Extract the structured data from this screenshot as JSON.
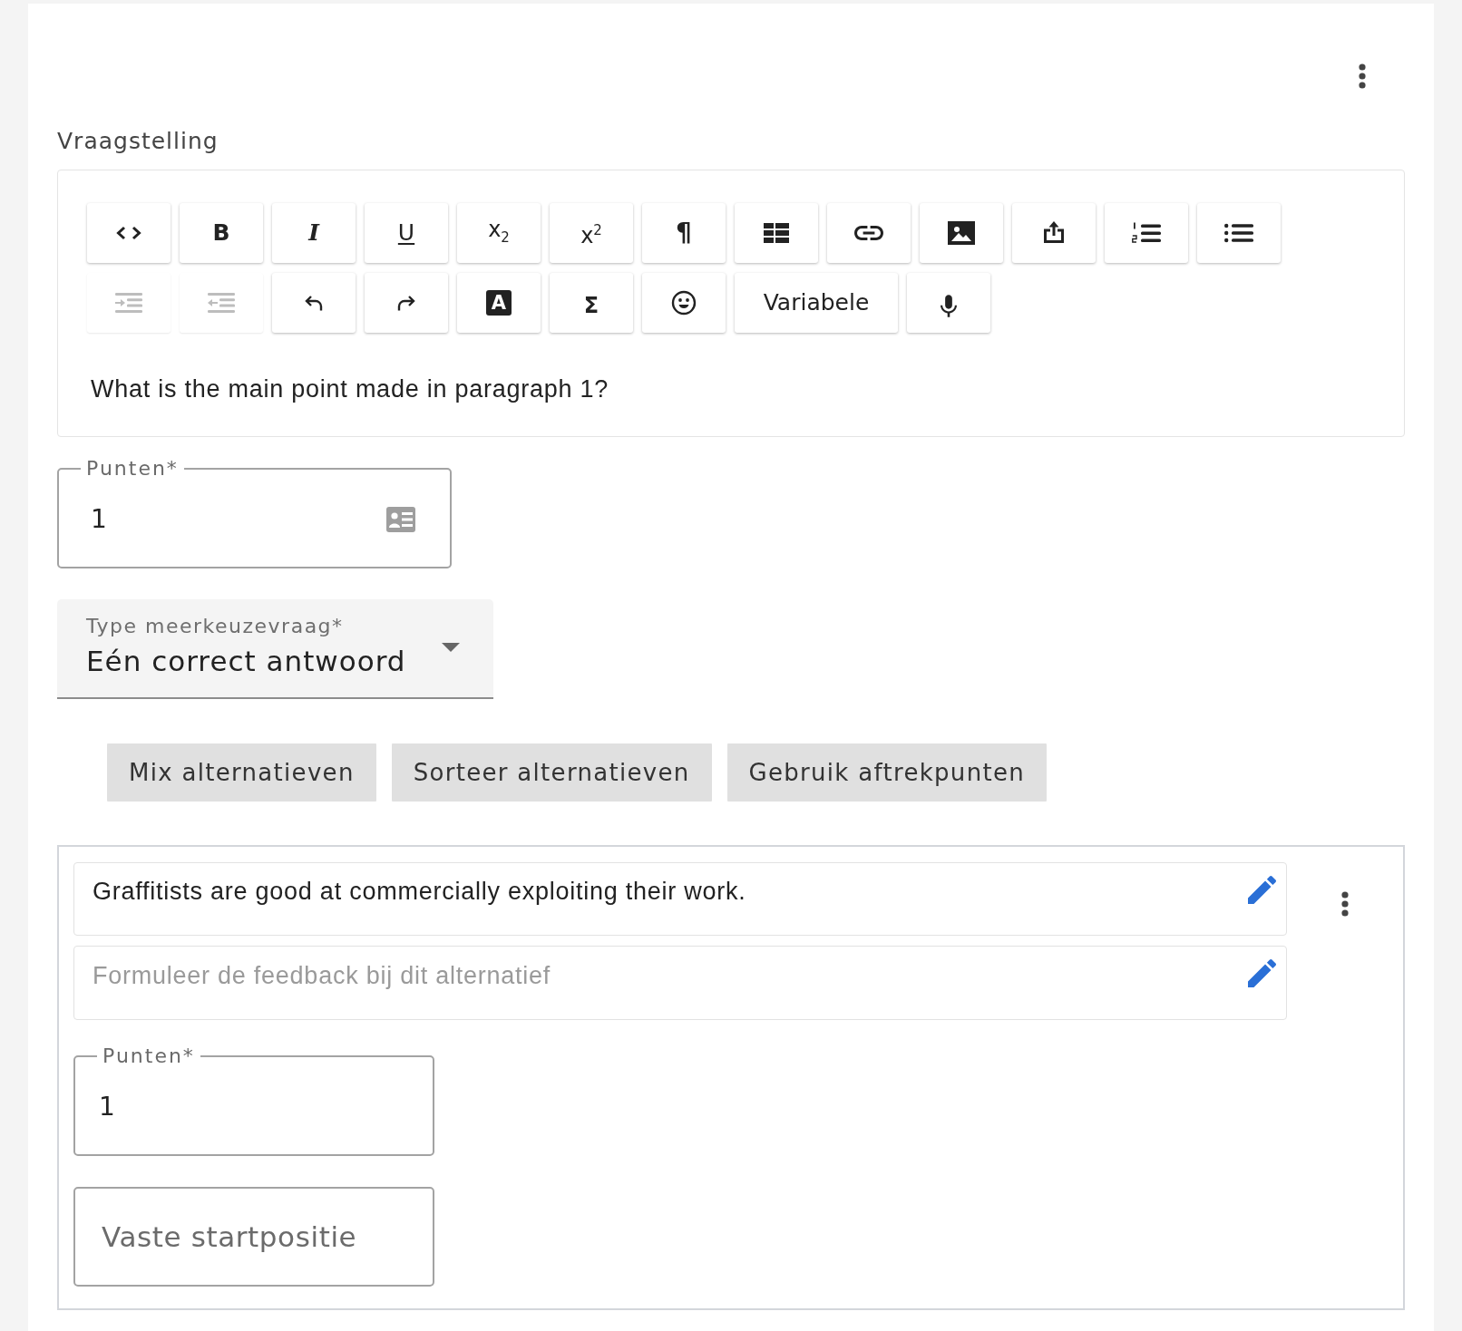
{
  "question": {
    "label": "Vraagstelling",
    "toolbar_rows": [
      [
        {
          "kind": "code",
          "disabled": false
        },
        {
          "kind": "bold",
          "label": "B",
          "disabled": false
        },
        {
          "kind": "italic",
          "label": "I",
          "disabled": false
        },
        {
          "kind": "underline",
          "label": "U",
          "disabled": false
        },
        {
          "kind": "subscript",
          "label": "x$_{2}$",
          "disabled": false
        },
        {
          "kind": "superscript",
          "label": "x$^{2}$",
          "disabled": false
        },
        {
          "kind": "paragraph",
          "label": "¶",
          "disabled": false
        },
        {
          "kind": "table",
          "disabled": false
        },
        {
          "kind": "link",
          "disabled": false
        },
        {
          "kind": "image",
          "disabled": false
        },
        {
          "kind": "upload",
          "disabled": false
        },
        {
          "kind": "numbered",
          "disabled": false
        },
        {
          "kind": "bulleted",
          "disabled": false
        }
      ],
      [
        {
          "kind": "indent",
          "disabled": true
        },
        {
          "kind": "outdent",
          "disabled": true
        },
        {
          "kind": "undo",
          "disabled": false
        },
        {
          "kind": "redo",
          "disabled": false
        },
        {
          "kind": "color",
          "label": "A",
          "disabled": false
        },
        {
          "kind": "formula",
          "label": "Σ",
          "disabled": false
        },
        {
          "kind": "emoji",
          "disabled": false
        },
        {
          "kind": "variable",
          "label": "Variabele",
          "disabled": false
        },
        {
          "kind": "microphone",
          "disabled": false
        }
      ]
    ],
    "text": "What is the main point made in paragraph 1?"
  },
  "points": {
    "label": "Punten*",
    "value": "1"
  },
  "question_type": {
    "label": "Type meerkeuzevraag*",
    "value": "Eén correct antwoord"
  },
  "actions": [
    "Mix alternatieven",
    "Sorteer alternatieven",
    "Gebruik aftrekpunten"
  ],
  "alternatives": [
    {
      "text": "Graffitists are good at commercially exploiting their work.",
      "feedback": {
        "placeholder": "Formuleer de feedback bij dit alternatief"
      },
      "points": {
        "label": "Punten*",
        "value": "1"
      },
      "fixed_position": {
        "placeholder": "Vaste startpositie"
      }
    }
  ]
}
